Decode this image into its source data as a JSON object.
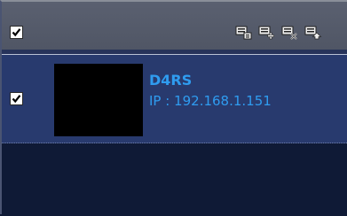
{
  "header": {
    "select_all_checked": true,
    "tools": [
      {
        "icon": "device-list-icon"
      },
      {
        "icon": "device-add-icon"
      },
      {
        "icon": "device-remove-icon"
      },
      {
        "icon": "device-move-up-icon"
      }
    ]
  },
  "devices": [
    {
      "checked": true,
      "name": "D4RS",
      "ip_text": "IP : 192.168.1.151"
    }
  ],
  "colors": {
    "accent_text": "#2f9cf0",
    "row_selected": "#283a6e",
    "panel_bg": "#0f1a36",
    "toolbar_bg": "#555b6a"
  }
}
